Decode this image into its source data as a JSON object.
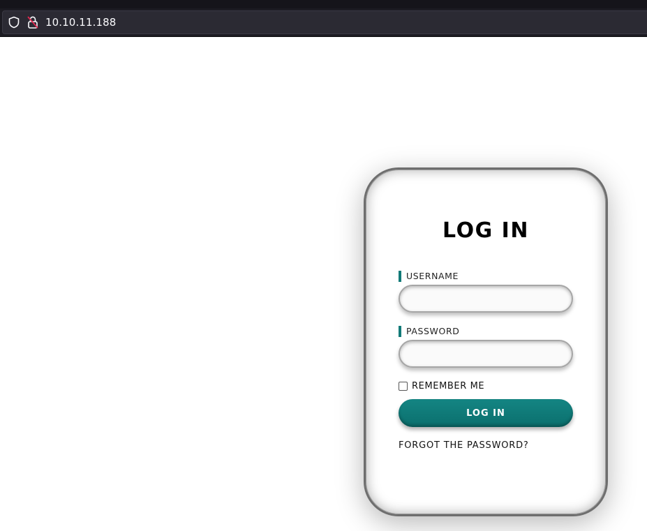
{
  "browser": {
    "url": "10.10.11.188",
    "icons": [
      "shield-icon",
      "insecure-lock-icon"
    ]
  },
  "login_card": {
    "title": "LOG IN",
    "username_label": "USERNAME",
    "username_value": "",
    "password_label": "PASSWORD",
    "password_value": "",
    "remember_label": "REMEMBER ME",
    "remember_checked": false,
    "submit_label": "LOG IN",
    "forgot_label": "FORGOT THE PASSWORD?"
  },
  "colors": {
    "accent": "#127a78",
    "browser_bg": "#1c1b22",
    "urlbar_bg": "#2b2a33",
    "lock_warning": "#e22850"
  }
}
